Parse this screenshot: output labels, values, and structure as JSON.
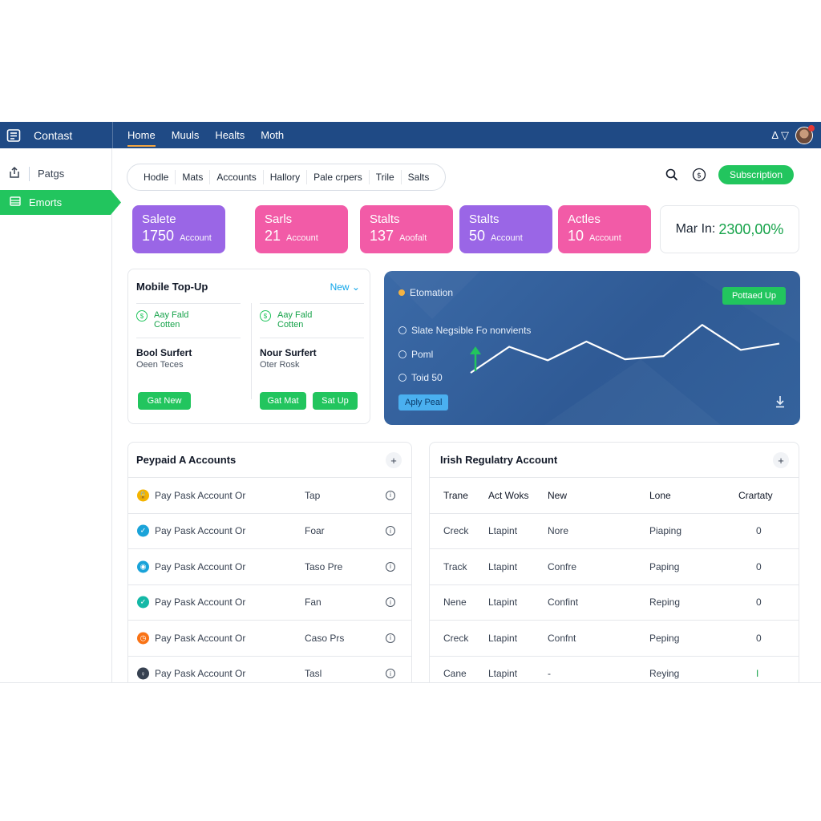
{
  "topbar": {
    "brand": "Contast",
    "nav": [
      "Home",
      "Muuls",
      "Healts",
      "Moth"
    ],
    "right_label": "Δ ▽"
  },
  "sidebar": {
    "item": "Patgs",
    "active_item": "Emorts"
  },
  "tabs": [
    "Hodle",
    "Mats",
    "Accounts",
    "Hallory",
    "Pale crpers",
    "Trile",
    "Salts"
  ],
  "header": {
    "subscribe_label": "Subscription"
  },
  "stats": [
    {
      "title": "Salete",
      "value": "1750",
      "unit": "Account",
      "color": "#9a66e6"
    },
    {
      "title": "Sarls",
      "value": "21",
      "unit": "Account",
      "color": "#f25ba7"
    },
    {
      "title": "Stalts",
      "value": "137",
      "unit": "Aoofalt",
      "color": "#f25ba7"
    },
    {
      "title": "Stalts",
      "value": "50",
      "unit": "Account",
      "color": "#9a66e6"
    },
    {
      "title": "Actles",
      "value": "10",
      "unit": "Account",
      "color": "#f25ba7"
    }
  ],
  "stat_wide": {
    "label": "Mar In:",
    "value": "2300,00%"
  },
  "mobile_topup": {
    "title": "Mobile Top-Up",
    "new_label": "New ⌄",
    "columns": [
      {
        "status_line1": "Aay Fald",
        "status_line2": "Cotten",
        "name": "Bool Surfert",
        "sub": "Oeen Teces"
      },
      {
        "status_line1": "Aay Fald",
        "status_line2": "Cotten",
        "name": "Nour Surfert",
        "sub": "Oter Rosk"
      }
    ],
    "buttons": [
      "Gat New",
      "Gat Mat",
      "Sat Up"
    ]
  },
  "estimation": {
    "title": "Etomation",
    "top_button": "Pottaed Up",
    "items": [
      "Slate  Negsible Fo nonvients",
      "Poml",
      "Toid 50"
    ],
    "bottom_button": "Aply Peal",
    "line_values": [
      10,
      35,
      22,
      40,
      23,
      26,
      56,
      32,
      38
    ]
  },
  "prepaid": {
    "title": "Peypaid A Accounts",
    "rows": [
      {
        "icon": "lock-icon",
        "icon_color": "#f4b400",
        "icon_glyph": "🔒",
        "name": "Pay Pask Account Or",
        "type": "Tap"
      },
      {
        "icon": "check-icon",
        "icon_color": "#1aa3d9",
        "icon_glyph": "✓",
        "name": "Pay Pask Account Or",
        "type": "Foar"
      },
      {
        "icon": "eye-icon",
        "icon_color": "#1aa3d9",
        "icon_glyph": "◉",
        "name": "Pay Pask Account Or",
        "type": "Taso Pre"
      },
      {
        "icon": "check-icon",
        "icon_color": "#14b8a6",
        "icon_glyph": "✓",
        "name": "Pay Pask Account Or",
        "type": "Fan"
      },
      {
        "icon": "clock-icon",
        "icon_color": "#f97316",
        "icon_glyph": "◷",
        "name": "Pay Pask Account Or",
        "type": "Caso Prs"
      },
      {
        "icon": "key-icon",
        "icon_color": "#374151",
        "icon_glyph": "♀",
        "name": "Pay Pask Account Or",
        "type": "Tasl"
      }
    ]
  },
  "regulatory": {
    "title": "Irish Regulatry Account",
    "headers": [
      "Trane",
      "Act Woks",
      "New",
      "Lone",
      "Crartaty"
    ],
    "rows": [
      [
        "Creck",
        "Ltapint",
        "Nore",
        "Piaping",
        "0"
      ],
      [
        "Track",
        "Ltapint",
        "Confre",
        "Paping",
        "0"
      ],
      [
        "Nene",
        "Ltapint",
        "Confint",
        "Reping",
        "0"
      ],
      [
        "Creck",
        "Ltapint",
        "Confnt",
        "Peping",
        "0"
      ],
      [
        "Cane",
        "Ltapint",
        "-",
        "Reying",
        "I"
      ]
    ]
  }
}
